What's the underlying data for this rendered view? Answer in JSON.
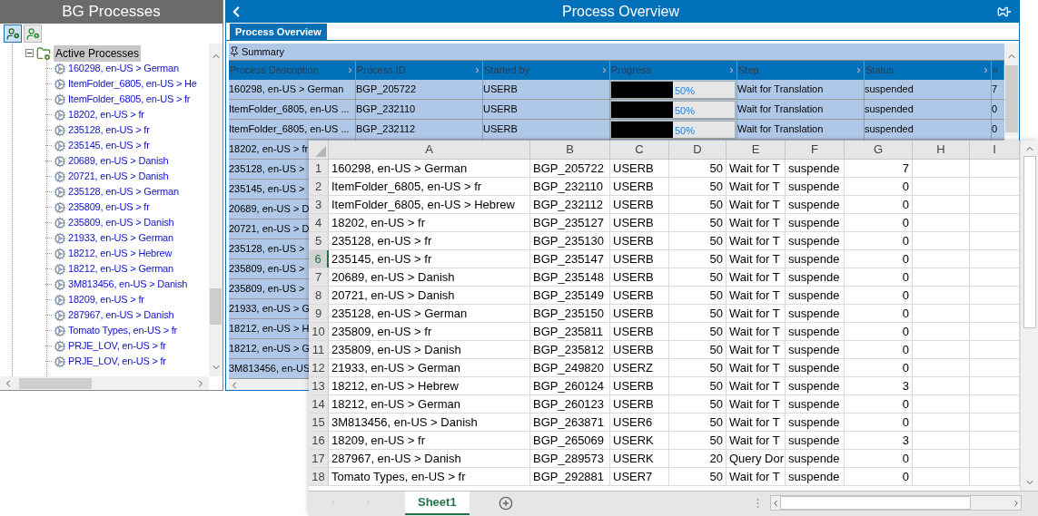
{
  "left_panel": {
    "title": "BG Processes",
    "toolbar": [
      {
        "selected": true
      },
      {
        "selected": false
      }
    ],
    "tree": {
      "label": "Active Processes",
      "expanded": true,
      "selected": true,
      "children": [
        {
          "label": "160298, en-US > German"
        },
        {
          "label": "ItemFolder_6805, en-US > He"
        },
        {
          "label": "ItemFolder_6805, en-US > fr"
        },
        {
          "label": "18202, en-US > fr"
        },
        {
          "label": "235128, en-US > fr"
        },
        {
          "label": "235145, en-US > fr"
        },
        {
          "label": "20689, en-US > Danish"
        },
        {
          "label": "20721, en-US > Danish"
        },
        {
          "label": "235128, en-US > German"
        },
        {
          "label": "235809, en-US > fr"
        },
        {
          "label": "235809, en-US > Danish"
        },
        {
          "label": "21933, en-US > German"
        },
        {
          "label": "18212, en-US > Hebrew"
        },
        {
          "label": "18212, en-US > German"
        },
        {
          "label": "3M813456, en-US > Danish"
        },
        {
          "label": "18209, en-US > fr"
        },
        {
          "label": "287967, en-US > Danish"
        },
        {
          "label": "Tomato Types, en-US > fr"
        },
        {
          "label": "PRJE_LOV, en-US > fr"
        },
        {
          "label": "PRJE_LOV, en-US > fr"
        }
      ]
    }
  },
  "right_panel": {
    "title": "Process Overview",
    "tabs": [
      {
        "label": "Process Overview",
        "selected": true
      }
    ],
    "summary": "Summary",
    "table": {
      "columns": [
        "Process Description",
        "Process ID",
        "Started by",
        "Progress",
        "Step",
        "Status",
        "#"
      ],
      "rows": [
        {
          "description": "160298, en-US > German",
          "id": "BGP_205722",
          "started_by": "USERB",
          "progress": {
            "level": 0.5,
            "label": "50%"
          },
          "step": "Wait for Translation",
          "status": "suspended",
          "count": "7"
        },
        {
          "description": "ItemFolder_6805, en-US ...",
          "id": "BGP_232110",
          "started_by": "USERB",
          "progress": {
            "level": 0.5,
            "label": "50%"
          },
          "step": "Wait for Translation",
          "status": "suspended",
          "count": "0"
        },
        {
          "description": "ItemFolder_6805, en-US ...",
          "id": "BGP_232112",
          "started_by": "USERB",
          "progress": {
            "level": 0.5,
            "label": "50%"
          },
          "step": "Wait for Translation",
          "status": "suspended",
          "count": "0"
        },
        {
          "description": "18202, en-US > fr"
        },
        {
          "description": "235128, en-US >"
        },
        {
          "description": "235145, en-US >"
        },
        {
          "description": "20689, en-US > D"
        },
        {
          "description": "20721, en-US > D"
        },
        {
          "description": "235128, en-US >"
        },
        {
          "description": "235809, en-US >"
        },
        {
          "description": "235809, en-US >"
        },
        {
          "description": "21933, en-US > G"
        },
        {
          "description": "18212, en-US > H"
        },
        {
          "description": "18212, en-US > G"
        },
        {
          "description": "3M813456, en-US"
        }
      ]
    }
  },
  "spreadsheet": {
    "columns": [
      "A",
      "B",
      "C",
      "D",
      "E",
      "F",
      "G",
      "H",
      "I"
    ],
    "rows": [
      {
        "number": "1",
        "selected": false,
        "cells": [
          "160298, en-US > German",
          "BGP_205722",
          "USERB",
          "50",
          "Wait for T",
          "suspende",
          "7"
        ]
      },
      {
        "number": "2",
        "selected": false,
        "cells": [
          "ItemFolder_6805, en-US > fr",
          "BGP_232110",
          "USERB",
          "50",
          "Wait for T",
          "suspende",
          "0"
        ]
      },
      {
        "number": "3",
        "selected": false,
        "cells": [
          "ItemFolder_6805, en-US > Hebrew",
          "BGP_232112",
          "USERB",
          "50",
          "Wait for T",
          "suspende",
          "0"
        ]
      },
      {
        "number": "4",
        "selected": false,
        "cells": [
          "18202, en-US > fr",
          "BGP_235127",
          "USERB",
          "50",
          "Wait for T",
          "suspende",
          "0"
        ]
      },
      {
        "number": "5",
        "selected": false,
        "cells": [
          "235128, en-US > fr",
          "BGP_235130",
          "USERB",
          "50",
          "Wait for T",
          "suspende",
          "0"
        ]
      },
      {
        "number": "6",
        "selected": true,
        "cells": [
          "235145, en-US > fr",
          "BGP_235147",
          "USERB",
          "50",
          "Wait for T",
          "suspende",
          "0"
        ]
      },
      {
        "number": "7",
        "selected": false,
        "cells": [
          "20689, en-US > Danish",
          "BGP_235148",
          "USERB",
          "50",
          "Wait for T",
          "suspende",
          "0"
        ]
      },
      {
        "number": "8",
        "selected": false,
        "cells": [
          "20721, en-US > Danish",
          "BGP_235149",
          "USERB",
          "50",
          "Wait for T",
          "suspende",
          "0"
        ]
      },
      {
        "number": "9",
        "selected": false,
        "cells": [
          "235128, en-US > German",
          "BGP_235150",
          "USERB",
          "50",
          "Wait for T",
          "suspende",
          "0"
        ]
      },
      {
        "number": "10",
        "selected": false,
        "cells": [
          "235809, en-US > fr",
          "BGP_235811",
          "USERB",
          "50",
          "Wait for T",
          "suspende",
          "0"
        ]
      },
      {
        "number": "11",
        "selected": false,
        "cells": [
          "235809, en-US > Danish",
          "BGP_235812",
          "USERB",
          "50",
          "Wait for T",
          "suspende",
          "0"
        ]
      },
      {
        "number": "12",
        "selected": false,
        "cells": [
          "21933, en-US > German",
          "BGP_249820",
          "USERZ",
          "50",
          "Wait for T",
          "suspende",
          "0"
        ]
      },
      {
        "number": "13",
        "selected": false,
        "cells": [
          "18212, en-US > Hebrew",
          "BGP_260124",
          "USERB",
          "50",
          "Wait for T",
          "suspende",
          "3"
        ]
      },
      {
        "number": "14",
        "selected": false,
        "cells": [
          "18212, en-US > German",
          "BGP_260123",
          "USERB",
          "50",
          "Wait for T",
          "suspende",
          "0"
        ]
      },
      {
        "number": "15",
        "selected": false,
        "cells": [
          "3M813456, en-US > Danish",
          "BGP_263871",
          "USER6",
          "50",
          "Wait for T",
          "suspende",
          "0"
        ]
      },
      {
        "number": "16",
        "selected": false,
        "cells": [
          "18209, en-US > fr",
          "BGP_265069",
          "USERK",
          "50",
          "Wait for T",
          "suspende",
          "3"
        ]
      },
      {
        "number": "17",
        "selected": false,
        "cells": [
          "287967, en-US > Danish",
          "BGP_289573",
          "USERK",
          "20",
          "Query Dor",
          "suspende",
          "0"
        ]
      },
      {
        "number": "18",
        "selected": false,
        "cells": [
          "Tomato Types, en-US > fr",
          "BGP_292881",
          "USER7",
          "50",
          "Wait for T",
          "suspende",
          "0"
        ]
      }
    ],
    "sheet_tabs": [
      {
        "label": "Sheet1",
        "selected": true
      }
    ]
  }
}
